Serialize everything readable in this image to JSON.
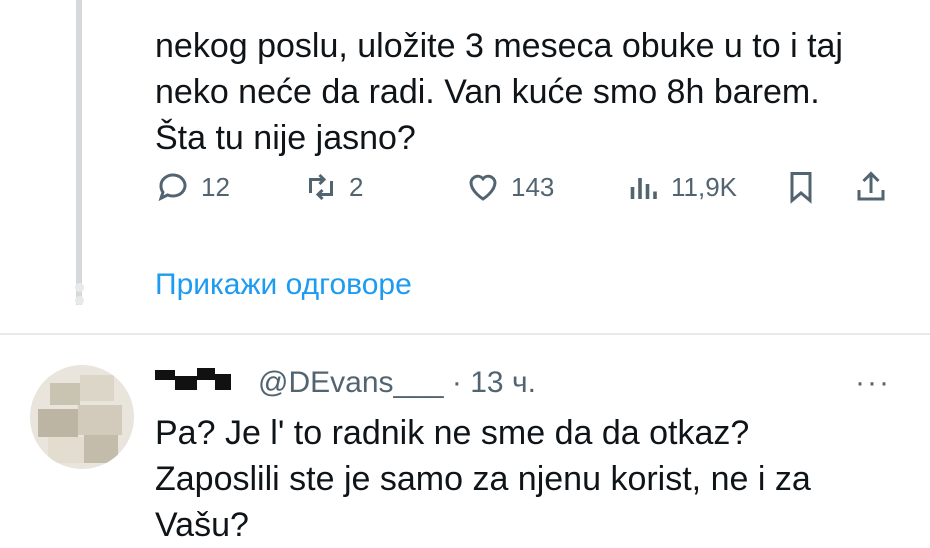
{
  "tweet": {
    "lines": [
      "nekog poslu, uložite 3 meseca obuke u to i taj",
      "neko neće da radi. Van kuće smo 8h barem.",
      "Šta tu nije jasno?"
    ],
    "actions": {
      "replies": "12",
      "reposts": "2",
      "likes": "143",
      "views": "11,9K"
    },
    "icons": [
      "reply-icon",
      "repost-icon",
      "like-icon",
      "views-icon",
      "bookmark-icon",
      "share-icon"
    ]
  },
  "show_replies": "Прикажи одговоре",
  "reply": {
    "handle": "@DEvans___",
    "separator": "·",
    "time": "13 ч.",
    "more": "···",
    "lines": [
      "Pa? Je l' to radnik ne sme da da otkaz?",
      "Zaposlili ste je samo za njenu korist, ne i za",
      "Vašu?"
    ]
  },
  "colors": {
    "text": "#0f1419",
    "secondary": "#536471",
    "link": "#1d9bf0",
    "thread_line": "#d6d9dc"
  }
}
